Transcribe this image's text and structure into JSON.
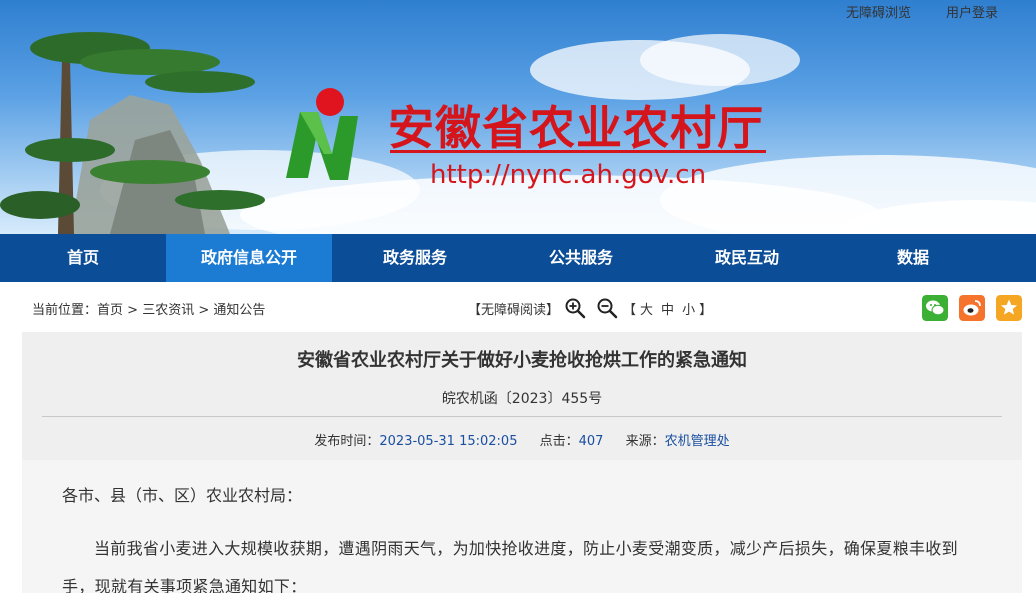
{
  "util": {
    "accessible": "无障碍浏览",
    "login": "用户登录"
  },
  "banner": {
    "title": "安徽省农业农村厅",
    "url": "http://nync.ah.gov.cn"
  },
  "nav": {
    "items": [
      "首页",
      "政府信息公开",
      "政务服务",
      "公共服务",
      "政民互动",
      "数据"
    ],
    "active_index": 1
  },
  "breadcrumb": {
    "prefix": "当前位置：",
    "items": [
      "首页",
      "三农资讯",
      "通知公告"
    ],
    "sep": " > "
  },
  "tools": {
    "accessible_read": "【无障碍阅读】",
    "size_open": "【",
    "size_large": "大",
    "size_medium": "中",
    "size_small": "小",
    "size_close": "】"
  },
  "article": {
    "title": "安徽省农业农村厅关于做好小麦抢收抢烘工作的紧急通知",
    "doc_number": "皖农机函〔2023〕455号",
    "meta": {
      "publish_label": "发布时间：",
      "publish_time": "2023-05-31 15:02:05",
      "clicks_label": "点击：",
      "clicks": "407",
      "source_label": "来源：",
      "source": "农机管理处"
    },
    "greeting": "各市、县（市、区）农业农村局：",
    "paragraph": "当前我省小麦进入大规模收获期，遭遇阴雨天气，为加快抢收进度，防止小麦受潮变质，减少产后损失，确保夏粮丰收到手，现就有关事项紧急通知如下："
  },
  "colors": {
    "nav_bg": "#0b4d96",
    "nav_active": "#1c7bd3",
    "title_red": "#d4161c",
    "meta_blue": "#1a4fa0"
  },
  "icons": [
    "zoom-in-icon",
    "zoom-out-icon",
    "wechat-icon",
    "weibo-icon",
    "favorite-star-icon",
    "logo-n-icon"
  ]
}
